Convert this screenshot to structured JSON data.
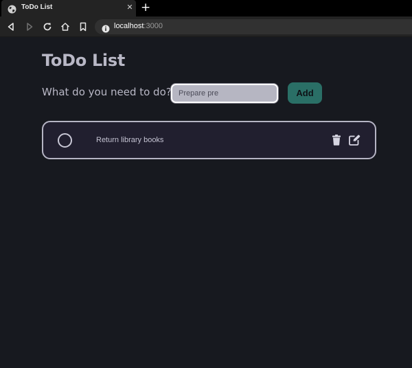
{
  "browser": {
    "tab_title": "ToDo List",
    "tab_close": "✕",
    "new_tab": "+",
    "url_host": "localhost",
    "url_port": ":3000"
  },
  "app": {
    "title": "ToDo List",
    "prompt_label": "What do you need to do?",
    "input_value": "Prepare pre",
    "input_placeholder": "",
    "add_label": "Add"
  },
  "todos": [
    {
      "text": "Return library books",
      "completed": false
    }
  ],
  "icons": {
    "tab": "globe-icon",
    "nav": [
      "back-icon",
      "forward-icon",
      "reload-icon",
      "home-icon",
      "bookmark-icon"
    ],
    "url": "info-icon",
    "todo_actions": [
      "trash-icon",
      "edit-icon"
    ]
  },
  "colors": {
    "background": "#17191f",
    "text": "#b9b8c6",
    "add_button": "#2a6f66",
    "item_background": "#211f2f",
    "item_border": "#b6b5c5"
  }
}
